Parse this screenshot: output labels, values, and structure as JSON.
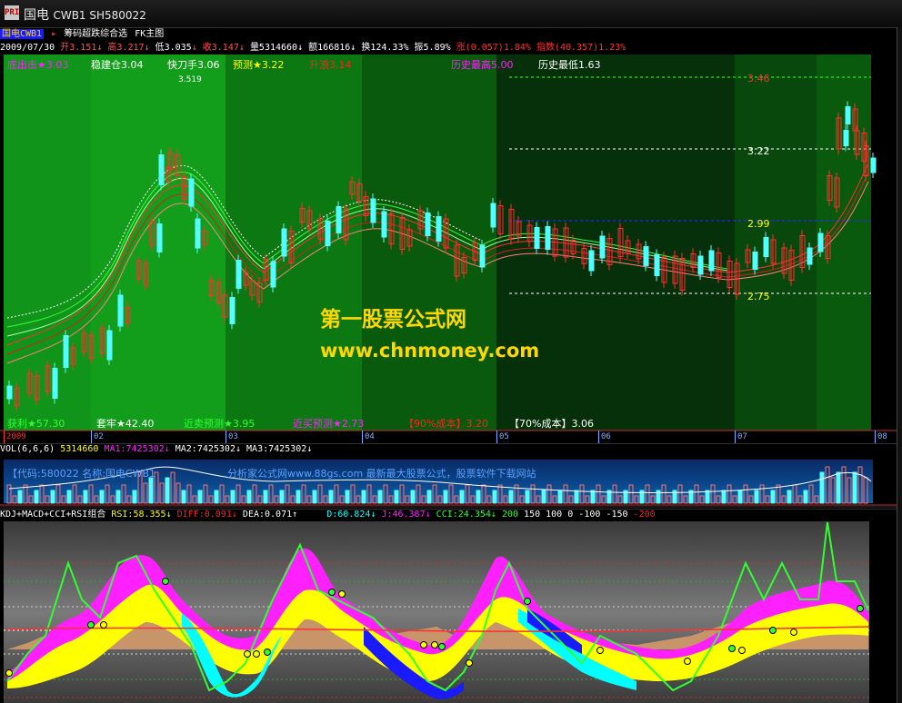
{
  "titlebar": {
    "logo": "PRI",
    "title": "国电",
    "symbol": "CWB1 SH580022"
  },
  "infobar": {
    "name": "国电CWB1",
    "formula_name": "筹码超跌综合选",
    "mode": "FK主图"
  },
  "quote": {
    "date": "2009/07/30",
    "open": "开3.151",
    "high": "高3.217",
    "low": "低3.035",
    "close": "收3.147",
    "volume": "量5314660",
    "amount": "额166816",
    "turnover": "换124.33%",
    "amplitude": "振5.89%",
    "change": "涨(0.057)1.84%",
    "index": "指数(40.357)1.23%"
  },
  "top_labels": {
    "bottom_strike": "底出击★3.03",
    "steady_build": "稳建仓3.04",
    "quick_cut": "快刀手3.06",
    "forecast": "预测★3.22",
    "rise": "升浪3.14",
    "hist_high": "历史最高5.00",
    "hist_low": "历史最低1.63"
  },
  "bottom_labels": {
    "profit": "获利★57.30",
    "trapped": "套牢★42.40",
    "near_sell": "近卖预测★3.95",
    "near_buy": "近买预测★2.73",
    "cost90": "【90%成本】3.20",
    "cost70": "【70%成本】3.06"
  },
  "price_levels": {
    "l346": "3.46",
    "l322": "3.22",
    "l299": "2.99",
    "l275": "2.75",
    "peak": "3.519"
  },
  "watermark": {
    "line1": "第一股票公式网",
    "line2": "www.chnmoney.com"
  },
  "axis": {
    "y2009": "2009",
    "m02": "02",
    "m03": "03",
    "m04": "04",
    "m05": "05",
    "m06": "06",
    "m07": "07",
    "m08": "08"
  },
  "volume": {
    "label": "VOL(6,6,6)",
    "val": "5314660",
    "ma1": "MA1:7425302",
    "ma2": "MA2:7425302",
    "ma3": "MA3:7425302",
    "info": "【代码:580022 名称:国电CWB1",
    "ad": "分析家公式网www.88gs.com 最新最大股票公式，股票软件下载网站"
  },
  "indicator": {
    "name": "KDJ+MACD+CCI+RSI组合",
    "rsi": "RSI:58.355",
    "diff": "DIFF:0.091",
    "dea": "DEA:0.071",
    "d": "D:60.824",
    "j": "J:46.387",
    "cci": "CCI:24.354",
    "l200": "200",
    "l150": "150",
    "l100": "100",
    "l0": "0",
    "lm100": "-100",
    "lm150": "-150",
    "lm200": "-200"
  },
  "colors": {
    "up": "#ff3030",
    "down": "#54ffff",
    "green_bg": "#0b6b12",
    "magenta": "#ff20ff",
    "yellow": "#ffff00",
    "cyan": "#00ffff",
    "blue": "#1a1aff",
    "tan": "#c8946a",
    "green_line": "#30ff30"
  }
}
